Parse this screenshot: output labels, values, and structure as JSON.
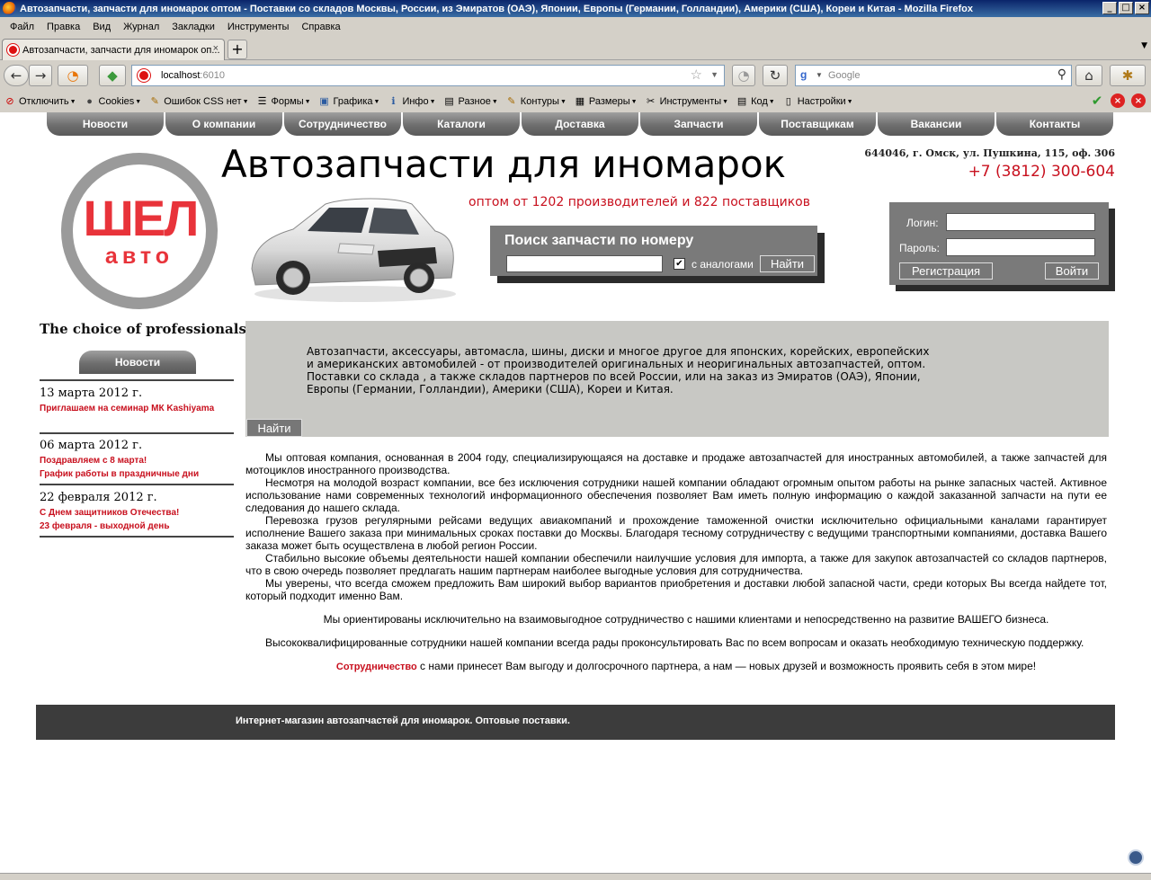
{
  "window": {
    "title": "Автозапчасти, запчасти для иномарок оптом - Поставки со складов Москвы, России, из Эмиратов (ОАЭ), Японии, Европы (Германии, Голландии), Америки (США), Кореи и Китая - Mozilla Firefox",
    "minimize": "_",
    "maximize": "□",
    "close": "×"
  },
  "menu": [
    "Файл",
    "Правка",
    "Вид",
    "Журнал",
    "Закладки",
    "Инструменты",
    "Справка"
  ],
  "tab": {
    "title": "Автозапчасти, запчасти для иномарок оп...",
    "close": "×",
    "new": "+"
  },
  "nav": {
    "back": "←",
    "forward": "→",
    "url_host": "localhost",
    "url_port": ":6010",
    "search_placeholder": "Google",
    "google_letter": "g"
  },
  "webdev": [
    {
      "label": "Отключить",
      "icon": "⊘"
    },
    {
      "label": "Cookies",
      "icon": "●"
    },
    {
      "label": "Ошибок CSS нет",
      "icon": "✎"
    },
    {
      "label": "Формы",
      "icon": "☰"
    },
    {
      "label": "Графика",
      "icon": "▣"
    },
    {
      "label": "Инфо",
      "icon": "ℹ"
    },
    {
      "label": "Разное",
      "icon": "▤"
    },
    {
      "label": "Контуры",
      "icon": "✎"
    },
    {
      "label": "Размеры",
      "icon": "▦"
    },
    {
      "label": "Инструменты",
      "icon": "✂"
    },
    {
      "label": "Код",
      "icon": "▤"
    },
    {
      "label": "Настройки",
      "icon": "▯"
    }
  ],
  "topnav": [
    "Новости",
    "О компании",
    "Сотрудничество",
    "Каталоги",
    "Доставка",
    "Запчасти",
    "Поставщикам",
    "Вакансии",
    "Контакты"
  ],
  "logo": {
    "line1": "ШЕЛ",
    "line2": "авто"
  },
  "tagline": "The choice of professionals",
  "site_title": "Автозапчасти для иномарок",
  "site_subtitle": "оптом от 1202 производителей и 822 поставщиков",
  "contact": {
    "address": "644046, г. Омск, ул. Пушкина, 115, оф. 306",
    "phone": "+7 (3812) 300-604"
  },
  "part_search": {
    "title": "Поиск запчасти по номеру",
    "analogs_label": "с аналогами",
    "analogs_checked": "✔",
    "button": "Найти"
  },
  "login": {
    "login_label": "Логин:",
    "password_label": "Пароль:",
    "register_button": "Регистрация",
    "submit_button": "Войти"
  },
  "news": {
    "tab_label": "Новости",
    "items": [
      {
        "date": "13 марта 2012 г.",
        "links": [
          "Приглашаем на семинар МК Kashiyama"
        ]
      },
      {
        "date": "06 марта 2012 г.",
        "links": [
          "Поздравляем с 8 марта!",
          "График работы в праздничные дни"
        ]
      },
      {
        "date": "22 февраля 2012 г.",
        "links": [
          "С Днем защитников Отечества!",
          "23 февраля - выходной день"
        ]
      }
    ]
  },
  "panel": {
    "text": "Автозапчасти, аксессуары, автомасла, шины, диски и многое другое для японских, корейских, европейских и американских автомобилей - от производителей оригинальных и неоригинальных автозапчастей, оптом. Поставки со склада , а также складов партнеров по всей России, или на заказ из Эмиратов (ОАЭ), Японии, Европы (Германии, Голландии), Америки (США), Кореи и Китая.",
    "button": "Найти"
  },
  "body": {
    "p1": "Мы оптовая компания, основанная в 2004 году, специализирующаяся на доставке и продаже автозапчастей для иностранных автомобилей, а также запчастей для мотоциклов иностранного производства.",
    "p2": " Несмотря на молодой возраст компании, все без исключения сотрудники нашей компании обладают огромным опытом работы на рынке запасных частей. Активное использование нами современных технологий информационного обеспечения позволяет Вам иметь полную информацию о каждой заказанной запчасти на пути ее следования до нашего склада.",
    "p3": "Перевозка грузов регулярными рейсами ведущих авиакомпаний и прохождение таможенной очистки исключительно официальными каналами гарантирует исполнение Вашего заказа при минимальных сроках поставки до Москвы. Благодаря тесному сотрудничеству с ведущими транспортными компаниями, доставка Вашего заказа может быть осуществлена в любой регион России.",
    "p4": "Стабильно высокие объемы деятельности нашей компании обеспечили наилучшие условия для импорта, а также для закупок автозапчастей со складов партнеров, что в свою очередь позволяет предлагать нашим партнерам наиболее выгодные условия для сотрудничества.",
    "p5": "Мы уверены, что всегда сможем предложить Вам широкий выбор вариантов приобретения и доставки любой запасной части, среди которых Вы всегда найдете тот, который подходит именно Вам.",
    "p6": "Мы ориентированы исключительно на взаимовыгодное сотрудничество с нашими клиентами и непосредственно на развитие ВАШЕГО бизнеса.",
    "p7": "Высококвалифицированные сотрудники нашей компании всегда рады проконсультировать Вас по всем вопросам и оказать необходимую техническую поддержку.",
    "p8_link": "Сотрудничество",
    "p8_rest": " с нами принесет Вам выгоду и долгосрочного партнера, а нам — новых друзей и возможность проявить себя в этом мире!"
  },
  "footer": "Интернет-магазин автозапчастей для иномарок. Оптовые поставки.",
  "colors": {
    "accent_red": "#c8101e",
    "nav_grey": "#6e6e6e",
    "panel_grey": "#c8c8c4",
    "footer_dark": "#3c3c3c"
  }
}
